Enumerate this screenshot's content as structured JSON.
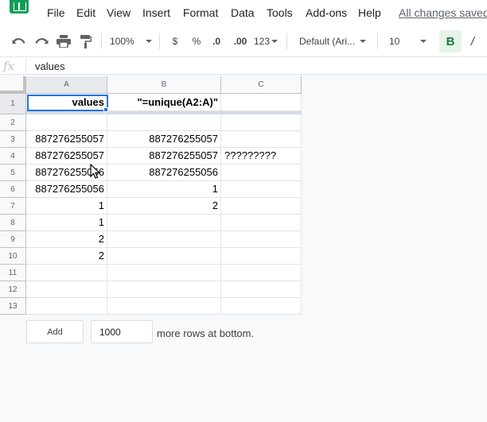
{
  "menu": {
    "items": [
      "File",
      "Edit",
      "View",
      "Insert",
      "Format",
      "Data",
      "Tools",
      "Add-ons",
      "Help"
    ],
    "status": "All changes saved"
  },
  "toolbar": {
    "undo_icon": "undo-icon",
    "redo_icon": "redo-icon",
    "print_icon": "print-icon",
    "paint_format_icon": "paint-format-icon",
    "zoom": "100%",
    "currency": "$",
    "percent": "%",
    "decrease_decimal": ".0",
    "increase_decimal": ".00",
    "more_formats": "123",
    "font": "Default (Ari...",
    "font_size": "10",
    "bold": "B",
    "italic": "/",
    "accent_color": "#188038"
  },
  "formula_bar": {
    "fx": "fx",
    "value": "values"
  },
  "sheet": {
    "columns": [
      "A",
      "B",
      "C"
    ],
    "rows": [
      "1",
      "2",
      "3",
      "4",
      "5",
      "6",
      "7",
      "8",
      "9",
      "10",
      "11",
      "12",
      "13"
    ],
    "cells": [
      [
        "values",
        "\"=unique(A2:A)\"",
        ""
      ],
      [
        "",
        "",
        ""
      ],
      [
        "887276255057",
        "887276255057",
        ""
      ],
      [
        "887276255057",
        "887276255057",
        "?????????"
      ],
      [
        "887276255056",
        "887276255056",
        ""
      ],
      [
        "887276255056",
        "1",
        ""
      ],
      [
        "1",
        "2",
        ""
      ],
      [
        "1",
        "",
        ""
      ],
      [
        "2",
        "",
        ""
      ],
      [
        "2",
        "",
        ""
      ],
      [
        "",
        "",
        ""
      ],
      [
        "",
        "",
        ""
      ],
      [
        "",
        "",
        ""
      ]
    ],
    "selection_color": "#1a73e8"
  },
  "add_rows": {
    "button": "Add",
    "count": "1000",
    "label": "more rows at bottom."
  }
}
